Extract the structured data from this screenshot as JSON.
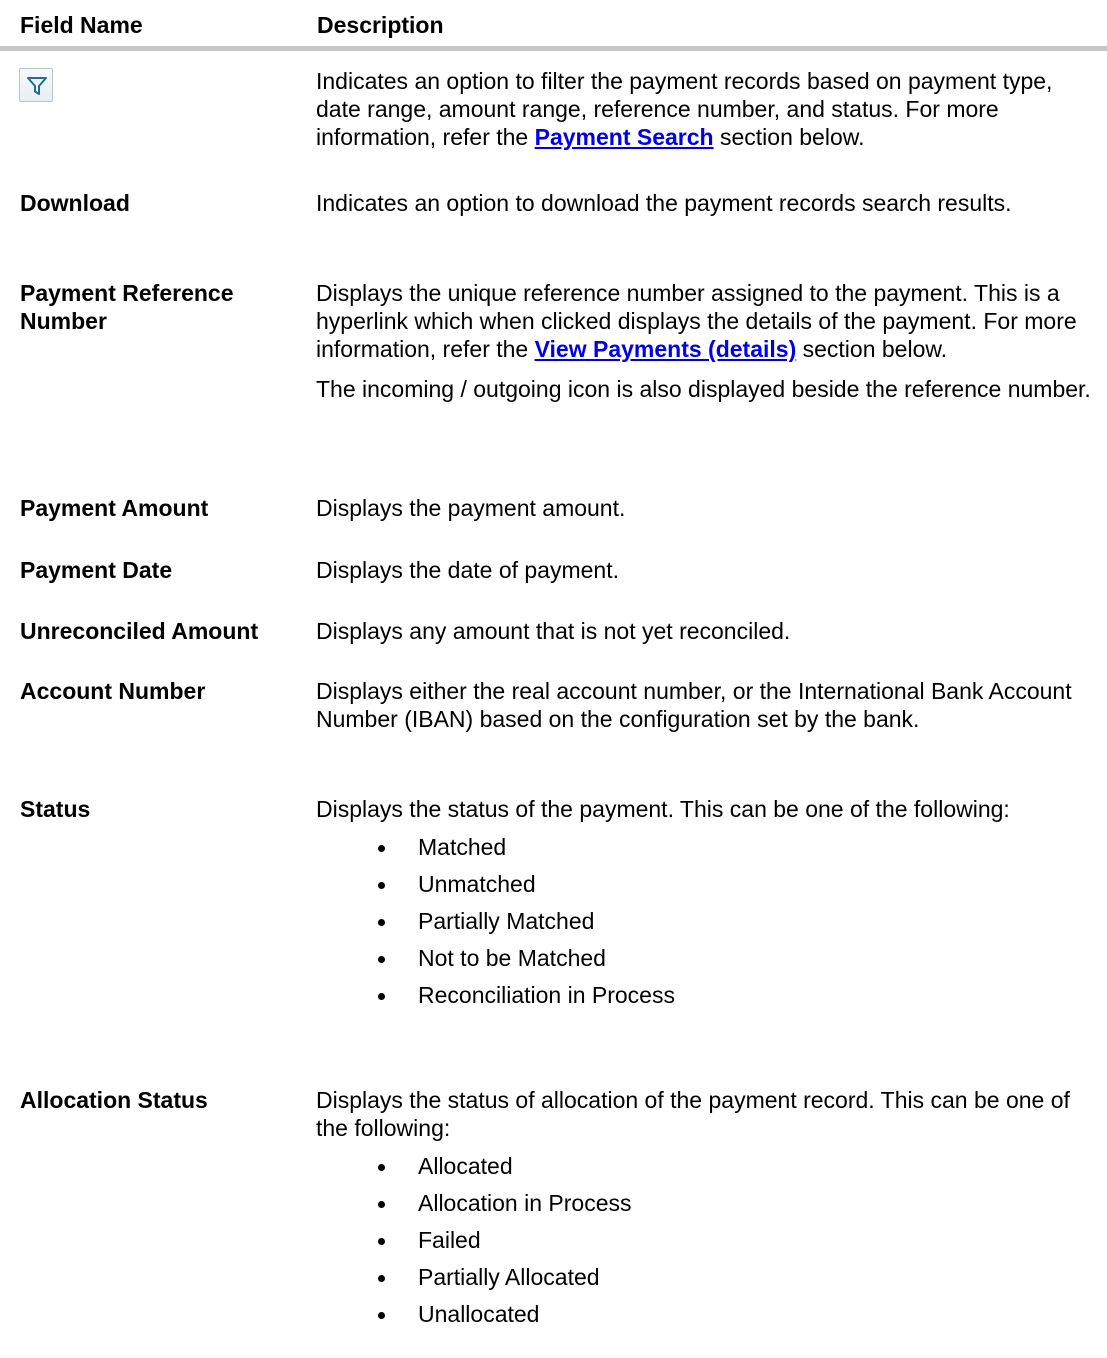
{
  "header": {
    "field": "Field Name",
    "description": "Description"
  },
  "rows": {
    "filter": {
      "icon": "filter-icon",
      "desc_pre": "Indicates an option to filter the payment records based on payment type, date range, amount range, reference number, and status. For more information, refer the ",
      "link": "Payment Search",
      "desc_post": " section below."
    },
    "download": {
      "name": "Download",
      "desc": "Indicates an option to download the payment records search results."
    },
    "ref": {
      "name": "Payment Reference Number",
      "desc_pre": "Displays the unique reference number assigned to the payment. This is a hyperlink which when clicked displays the details of the payment. For more information, refer the ",
      "link": "View Payments (details)",
      "desc_post": " section below.",
      "note": "The incoming / outgoing icon is also displayed beside the reference number."
    },
    "amount": {
      "name": "Payment Amount",
      "desc": "Displays the payment amount."
    },
    "date": {
      "name": "Payment Date",
      "desc": "Displays the date of payment."
    },
    "unrec": {
      "name": "Unreconciled Amount",
      "desc": "Displays any amount that is not yet reconciled."
    },
    "account": {
      "name": "Account Number",
      "desc": "Displays either the real account number, or the International Bank Account Number (IBAN) based on the configuration set by the bank."
    },
    "status": {
      "name": "Status",
      "desc": "Displays the status of the payment. This can be one of the following:",
      "items": [
        "Matched",
        "Unmatched",
        "Partially Matched",
        "Not to be Matched",
        "Reconciliation in Process"
      ]
    },
    "alloc": {
      "name": "Allocation Status",
      "desc": "Displays the status of allocation of the payment record. This can be one of the following:",
      "items": [
        "Allocated",
        "Allocation in Process",
        "Failed",
        "Partially Allocated",
        "Unallocated"
      ]
    }
  }
}
